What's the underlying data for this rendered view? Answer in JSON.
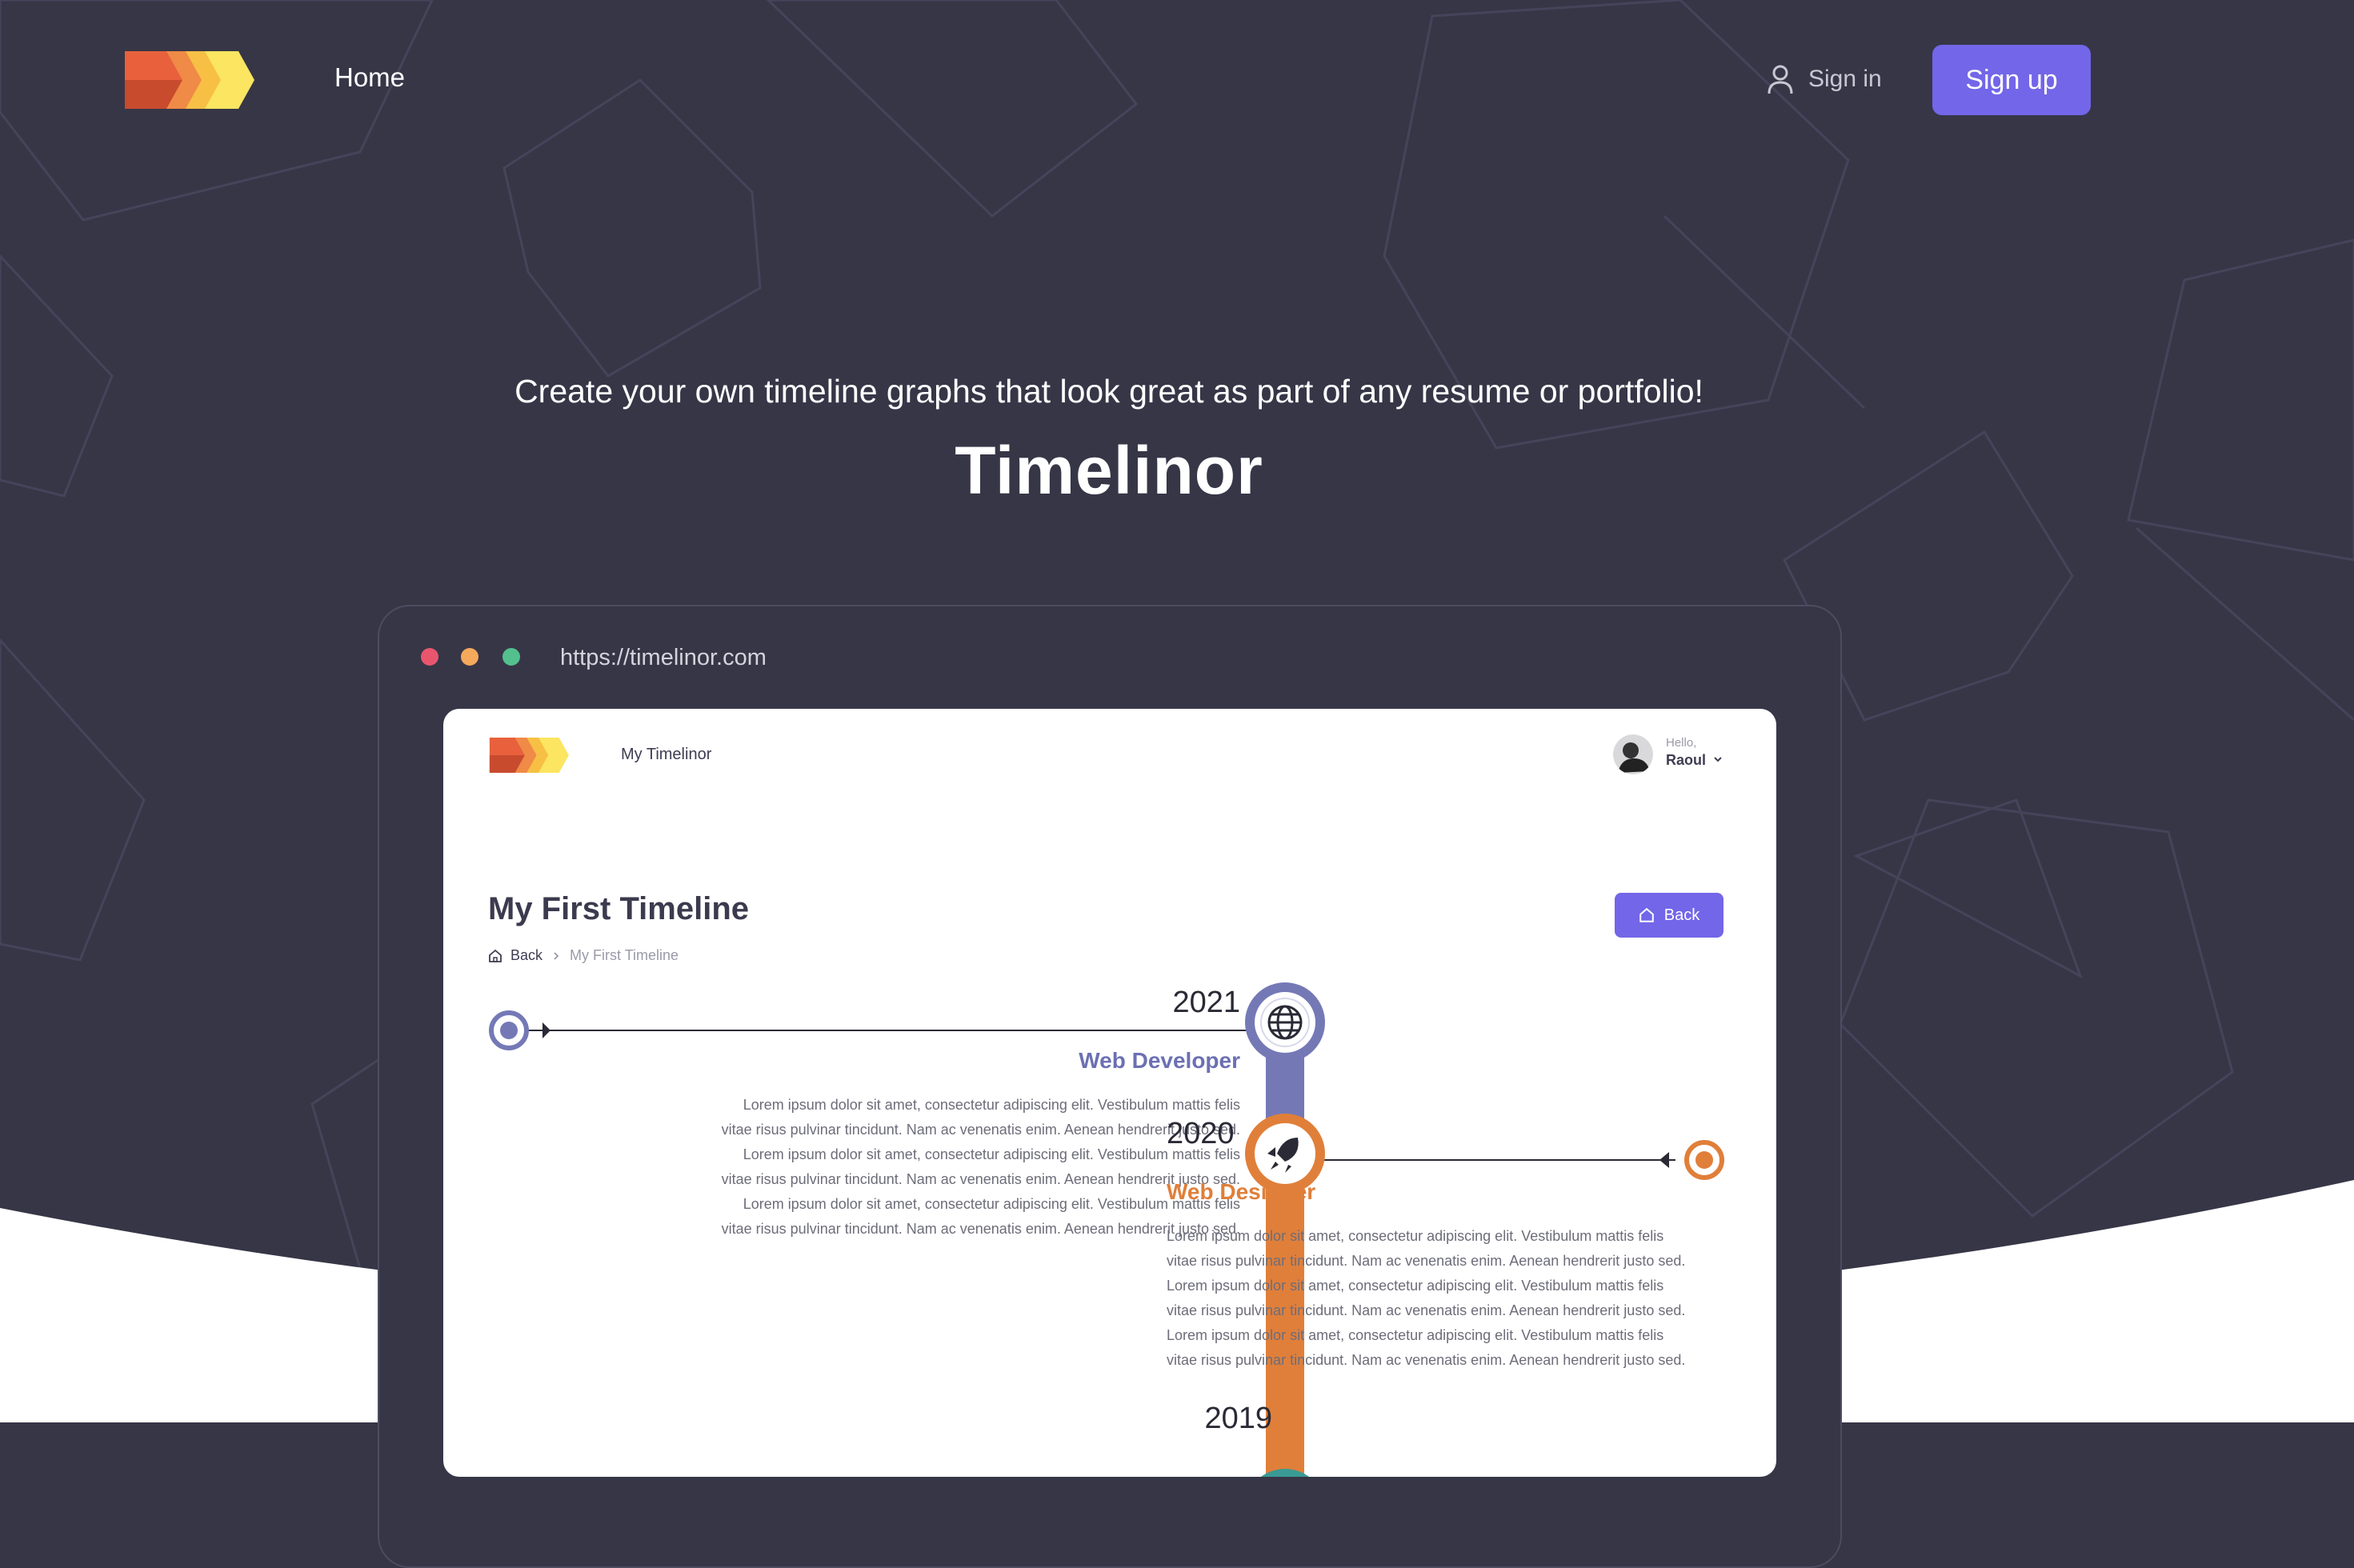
{
  "nav": {
    "home": "Home",
    "signin": "Sign in",
    "signup": "Sign up"
  },
  "hero": {
    "subtitle": "Create your own timeline graphs that look great as part of any resume or portfolio!",
    "title": "Timelinor"
  },
  "browser": {
    "url": "https://timelinor.com"
  },
  "app": {
    "nav_label": "My Timelinor",
    "user": {
      "greeting": "Hello,",
      "name": "Raoul"
    },
    "page_title": "My First Timeline",
    "breadcrumb": {
      "back": "Back",
      "current": "My First Timeline"
    },
    "back_button": "Back"
  },
  "timeline": {
    "entries": [
      {
        "year": "2021",
        "role": "Web Developer",
        "icon": "globe-icon",
        "color": "#7479b6",
        "description": "Lorem ipsum dolor sit amet, consectetur adipiscing elit. Vestibulum mattis felis vitae risus pulvinar tincidunt. Nam ac venenatis enim. Aenean hendrerit justo sed. Lorem ipsum dolor sit amet, consectetur adipiscing elit. Vestibulum mattis felis vitae risus pulvinar tincidunt. Nam ac venenatis enim. Aenean hendrerit justo sed. Lorem ipsum dolor sit amet, consectetur adipiscing elit. Vestibulum mattis felis vitae risus pulvinar tincidunt. Nam ac venenatis enim. Aenean hendrerit justo sed."
      },
      {
        "year": "2020",
        "role": "Web Designer",
        "icon": "rocket-icon",
        "color": "#e07f3a",
        "description": "Lorem ipsum dolor sit amet, consectetur adipiscing elit. Vestibulum mattis felis vitae risus pulvinar tincidunt. Nam ac venenatis enim. Aenean hendrerit justo sed. Lorem ipsum dolor sit amet, consectetur adipiscing elit. Vestibulum mattis felis vitae risus pulvinar tincidunt. Nam ac venenatis enim. Aenean hendrerit justo sed. Lorem ipsum dolor sit amet, consectetur adipiscing elit. Vestibulum mattis felis vitae risus pulvinar tincidunt. Nam ac venenatis enim. Aenean hendrerit justo sed."
      },
      {
        "year": "2019",
        "color": "#3a9a94"
      }
    ]
  },
  "colors": {
    "background": "#373647",
    "accent": "#7366e8",
    "white": "#ffffff"
  }
}
